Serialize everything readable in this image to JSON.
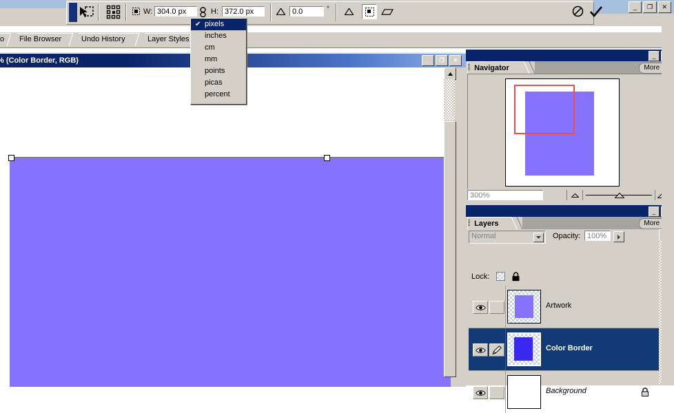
{
  "window": {
    "minimize_label": "_",
    "restore_label": "❐",
    "close_label": "✕"
  },
  "options_bar": {
    "tool_icon": "move-transform-icon",
    "transform_icon": "reference-point-icon",
    "width_icon": "width-icon",
    "width_label": "W:",
    "width_value": "304.0 px",
    "link_icon": "chain-link-icon",
    "height_label": "H:",
    "height_value": "372.0 px",
    "angle_icon": "angle-icon",
    "angle_value": "0.0",
    "degree_symbol": "°",
    "skew_h_icon": "skew-horizontal-icon",
    "warp_icon": "warp-mode-icon",
    "skew_v_icon": "skew-vertical-icon",
    "cancel_icon": "cancel-transform-icon",
    "cancel_glyph": "⊘",
    "commit_icon": "commit-transform-icon",
    "commit_glyph": "✔"
  },
  "unit_menu": {
    "name": "units-dropdown",
    "checkmark": "✔",
    "items": [
      {
        "label": "pixels",
        "selected": true
      },
      {
        "label": "inches",
        "selected": false
      },
      {
        "label": "cm",
        "selected": false
      },
      {
        "label": "mm",
        "selected": false
      },
      {
        "label": "points",
        "selected": false
      },
      {
        "label": "picas",
        "selected": false
      },
      {
        "label": "percent",
        "selected": false
      }
    ]
  },
  "palette_tabs": [
    {
      "label": "o"
    },
    {
      "label": "File Browser"
    },
    {
      "label": "Undo History"
    },
    {
      "label": "Layer Styles"
    }
  ],
  "document_window": {
    "title": "% (Color Border, RGB)",
    "minimize_label": "_",
    "maximize_label": "❐",
    "close_label": "✕",
    "canvas_color": "#8672fc",
    "selection_handle": "transform-handle"
  },
  "navigator": {
    "title_text": "",
    "tab_label": "Navigator",
    "more_label": "More",
    "more_arrow": "▸",
    "zoom_value": "300%",
    "zoom_out_icon": "zoom-out-triangle-icon",
    "zoom_in_icon": "zoom-in-triangle-icon",
    "slider_icon": "zoom-slider-thumb",
    "view_box_color": "#f04a4a",
    "proxy_color": "#8672fc",
    "minimize_label": "_",
    "close_label": "✕"
  },
  "layers": {
    "tab_label": "Layers",
    "more_label": "More",
    "more_arrow": "▸",
    "blend_mode": "Normal",
    "blend_arrow": "▼",
    "opacity_label": "Opacity:",
    "opacity_value": "100%",
    "opacity_arrow": "▸",
    "lock_label": "Lock:",
    "lock_transparency_icon": "lock-transparent-pixels-icon",
    "lock_all_icon": "lock-all-icon",
    "minimize_label": "_",
    "close_label": "✕",
    "rows": [
      {
        "name": "Artwork",
        "visible": true,
        "eye_icon": "eye-icon",
        "link_icon": "",
        "selected": false,
        "italic": false,
        "locked": false,
        "thumb_color": "#8672fc"
      },
      {
        "name": "Color Border",
        "visible": true,
        "eye_icon": "eye-icon",
        "link_icon": "brush-icon",
        "selected": true,
        "italic": false,
        "locked": false,
        "thumb_color": "#3a28f0"
      },
      {
        "name": "Background",
        "visible": true,
        "eye_icon": "eye-icon",
        "link_icon": "",
        "selected": false,
        "italic": true,
        "locked": true,
        "lock_icon": "lock-icon",
        "thumb_color": "#ffffff"
      }
    ]
  }
}
